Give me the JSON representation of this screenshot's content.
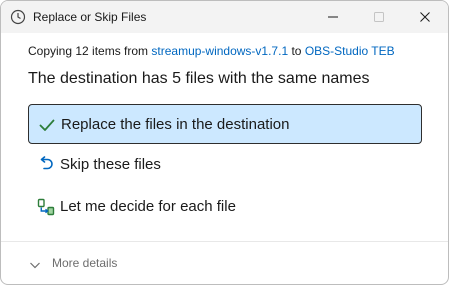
{
  "window": {
    "title": "Replace or Skip Files",
    "app_icon": "clock-icon"
  },
  "copy_info": {
    "prefix": "Copying 12 items from ",
    "source": "streamup-windows-v1.7.1",
    "middle": " to ",
    "destination": "OBS-Studio TEB"
  },
  "headline": "The destination has 5 files with the same names",
  "options": [
    {
      "label": "Replace the files in the destination",
      "icon": "checkmark-icon",
      "selected": true
    },
    {
      "label": "Skip these files",
      "icon": "skip-arrow-icon",
      "selected": false
    },
    {
      "label": "Let me decide for each file",
      "icon": "compare-files-icon",
      "selected": false
    }
  ],
  "footer": {
    "more_details": "More details",
    "icon": "chevron-down-icon"
  },
  "colors": {
    "accent": "#0067c0",
    "selected_bg": "#cce8ff",
    "check_green": "#2d7d3a"
  }
}
